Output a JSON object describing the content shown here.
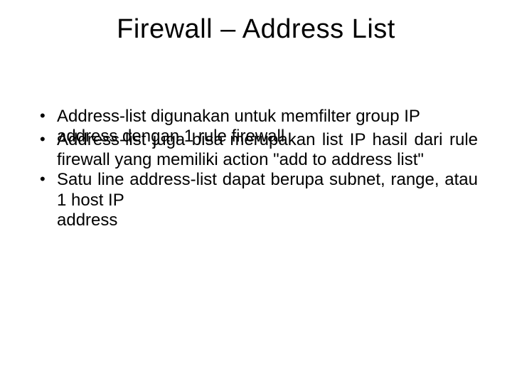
{
  "title": "Firewall – Address List",
  "bullets": {
    "b1_line1": "Address-list digunakan untuk memfilter group IP",
    "b1_line2": "address dengan 1 rule firewall",
    "b2": "Address-list juga bisa merupakan list IP hasil dari rule firewall yang memiliki action \"add to address list\"",
    "b3_line1": "Satu line address-list dapat berupa subnet, range, atau 1 host IP",
    "b3_line2": "address"
  }
}
